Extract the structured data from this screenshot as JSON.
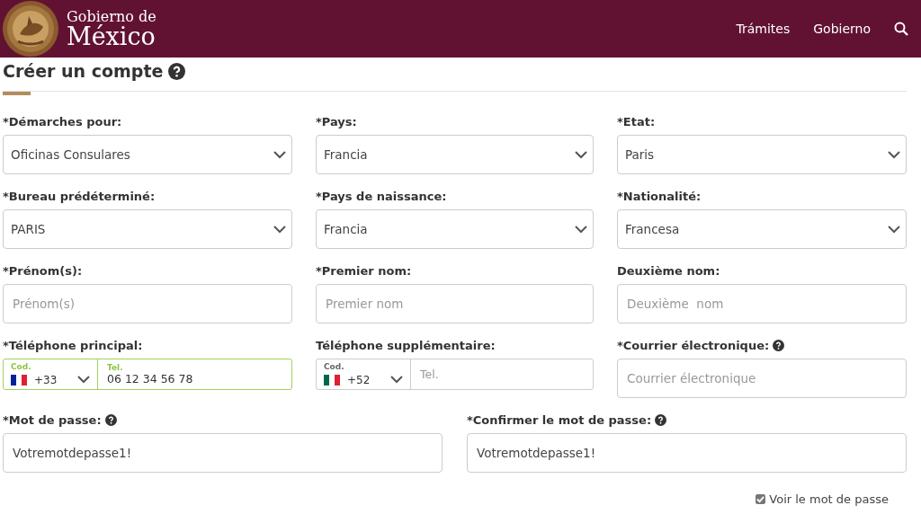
{
  "header": {
    "logo_line_1": "Gobierno de",
    "logo_line_2": "México",
    "nav": [
      "Trámites",
      "Gobierno"
    ]
  },
  "page": {
    "title": "Créer un compte",
    "title_help": true
  },
  "rows": [
    {
      "kind": "triple",
      "fields": [
        {
          "kind": "select",
          "label": "*Démarches pour:",
          "value": "Oficinas Consulares"
        },
        {
          "kind": "select",
          "label": "*Pays:",
          "value": "Francia"
        },
        {
          "kind": "select",
          "label": "*Etat:",
          "value": "Paris"
        }
      ]
    },
    {
      "kind": "triple",
      "fields": [
        {
          "kind": "select",
          "label": "*Bureau prédéterminé:",
          "value": "PARIS"
        },
        {
          "kind": "select",
          "label": "*Pays de naissance:",
          "value": "Francia"
        },
        {
          "kind": "select",
          "label": "*Nationalité:",
          "value": "Francesa"
        }
      ]
    },
    {
      "kind": "triple",
      "fields": [
        {
          "kind": "text",
          "label": "*Prénom(s):",
          "placeholder": "Prénom(s)"
        },
        {
          "kind": "text",
          "label": "*Premier nom:",
          "placeholder": "Premier nom"
        },
        {
          "kind": "text",
          "label": "Deuxième nom:",
          "placeholder": "Deuxième  nom"
        }
      ]
    },
    {
      "kind": "triple",
      "fields": [
        {
          "kind": "phone",
          "label": "*Téléphone principal:",
          "focused": true,
          "code_label": "Cod.",
          "color": "#002395",
          "code": "+33",
          "tel_label": "Tel.",
          "value": "06 12 34 56 78"
        },
        {
          "kind": "phone",
          "label": "Téléphone supplémentaire:",
          "focused": false,
          "code_label": "Cod.",
          "color": "#006847",
          "code": "+52",
          "placeholder": "Tel."
        },
        {
          "kind": "text",
          "label": "*Courrier électronique:",
          "help": true,
          "placeholder": "Courrier électronique"
        }
      ]
    },
    {
      "kind": "pair",
      "fields": [
        {
          "kind": "text",
          "label": "*Mot de passe:",
          "help": true,
          "value": "Votremotdepasse1!"
        },
        {
          "kind": "text",
          "label": "*Confirmer le mot de passe:",
          "help": true,
          "value": "Votremotdepasse1!"
        }
      ]
    }
  ],
  "show_password": {
    "label": "Voir le mot de passe",
    "checked": true
  }
}
